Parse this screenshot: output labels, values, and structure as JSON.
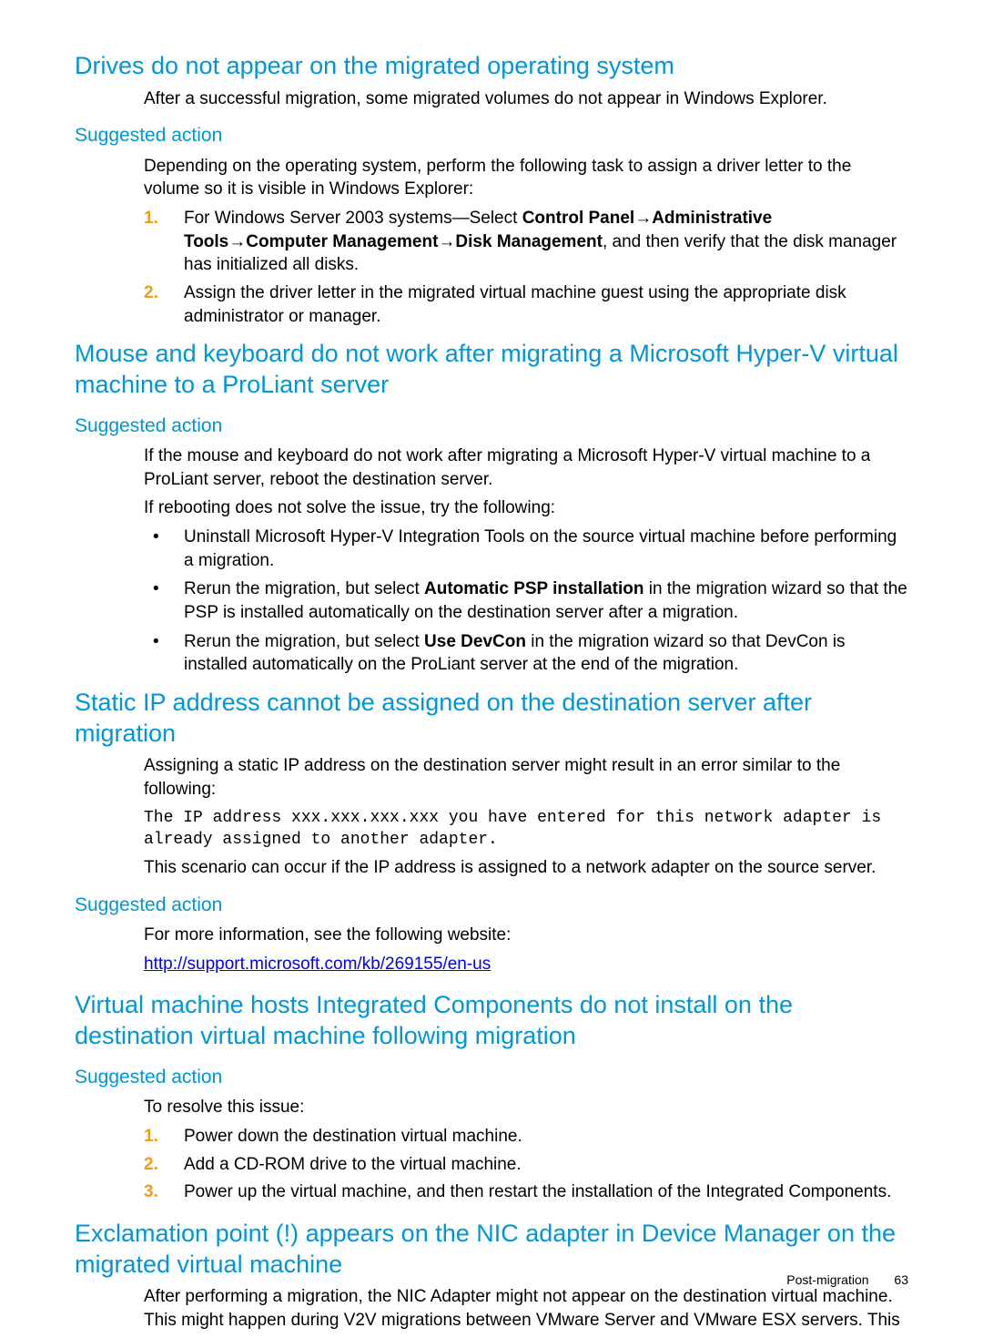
{
  "s1": {
    "h": "Drives do not appear on the migrated operating system",
    "p1": "After a successful migration, some migrated volumes do not appear in Windows Explorer.",
    "sa": "Suggested action",
    "p2": "Depending on the operating system, perform the following task to assign a driver letter to the volume so it is visible in Windows Explorer:",
    "li1a": "For Windows Server 2003 systems—Select ",
    "li1b1": "Control Panel",
    "li1b2": "Administrative Tools",
    "li1b3": "Computer Management",
    "li1b4": "Disk Management",
    "li1c": ", and then verify that the disk manager has initialized all disks.",
    "li2": "Assign the driver letter in the migrated virtual machine guest using the appropriate disk administrator or manager."
  },
  "s2": {
    "h": "Mouse and keyboard do not work after migrating a Microsoft Hyper-V virtual machine to a ProLiant server",
    "sa": "Suggested action",
    "p1": "If the mouse and keyboard do not work after migrating a Microsoft Hyper-V virtual machine to a ProLiant server, reboot the destination server.",
    "p2": "If rebooting does not solve the issue, try the following:",
    "b1": "Uninstall Microsoft Hyper-V Integration Tools on the source virtual machine before performing a migration.",
    "b2a": "Rerun the migration, but select ",
    "b2b": "Automatic PSP installation",
    "b2c": " in the migration wizard so that the PSP is installed automatically on the destination server after a migration.",
    "b3a": "Rerun the migration, but select ",
    "b3b": "Use DevCon",
    "b3c": " in the migration wizard so that DevCon is installed automatically on the ProLiant server at the end of the migration."
  },
  "s3": {
    "h": "Static IP address cannot be assigned on the destination server after migration",
    "p1": "Assigning a static IP address on the destination server might result in an error similar to the following:",
    "code": "The IP address xxx.xxx.xxx.xxx you have entered for this network adapter is already assigned to another adapter.",
    "p2": "This scenario can occur if the IP address is assigned to a network adapter on the source server.",
    "sa": "Suggested action",
    "p3": "For more information, see the following website:",
    "link": "http://support.microsoft.com/kb/269155/en-us"
  },
  "s4": {
    "h": "Virtual machine hosts Integrated Components do not install on the destination virtual machine following migration",
    "sa": "Suggested action",
    "p1": "To resolve this issue:",
    "li1": "Power down the destination virtual machine.",
    "li2": "Add a CD-ROM drive to the virtual machine.",
    "li3": "Power up the virtual machine, and then restart the installation of the Integrated Components."
  },
  "s5": {
    "h": "Exclamation point (!) appears on the NIC adapter in Device Manager on the migrated virtual machine",
    "p1": "After performing a migration, the NIC Adapter might not appear on the destination virtual machine. This might happen during V2V migrations between VMware Server and VMware ESX servers. This"
  },
  "footer": {
    "section": "Post-migration",
    "page": "63"
  }
}
